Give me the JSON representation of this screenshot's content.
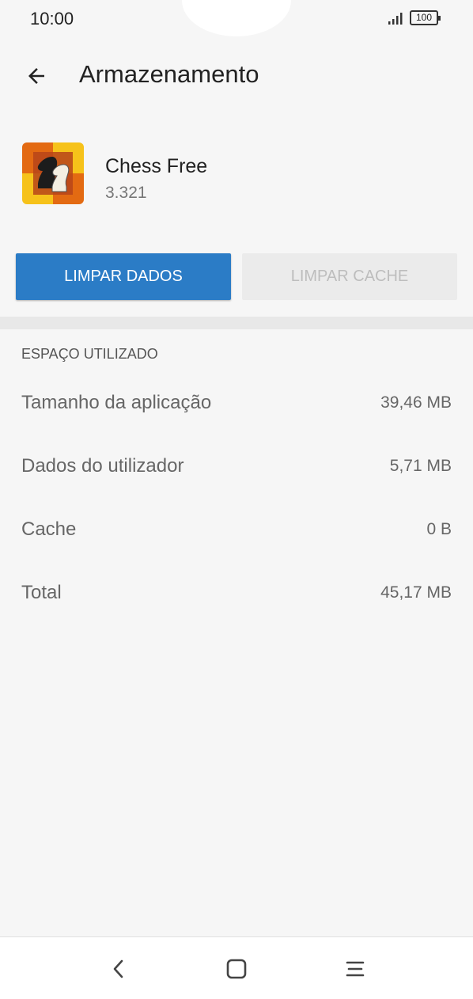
{
  "status_bar": {
    "time": "10:00",
    "battery": "100",
    "signal_icon": "signal-icon"
  },
  "app_bar": {
    "title": "Armazenamento",
    "back_icon": "arrow-left-icon"
  },
  "app_info": {
    "name": "Chess Free",
    "version": "3.321",
    "icon": "chess-knight-icon"
  },
  "buttons": {
    "clear_data": "LIMPAR DADOS",
    "clear_cache": "LIMPAR CACHE"
  },
  "storage": {
    "header": "ESPAÇO UTILIZADO",
    "rows": [
      {
        "label": "Tamanho da aplicação",
        "value": "39,46 MB"
      },
      {
        "label": "Dados do utilizador",
        "value": "5,71 MB"
      },
      {
        "label": "Cache",
        "value": "0 B"
      },
      {
        "label": "Total",
        "value": "45,17 MB"
      }
    ]
  },
  "nav_bar": {
    "back_icon": "chevron-left-icon",
    "home_icon": "square-home-icon",
    "menu_icon": "menu-icon"
  },
  "colors": {
    "primary_button": "#2b7cc6",
    "background": "#f6f6f6",
    "disabled_button": "#ebebeb"
  }
}
